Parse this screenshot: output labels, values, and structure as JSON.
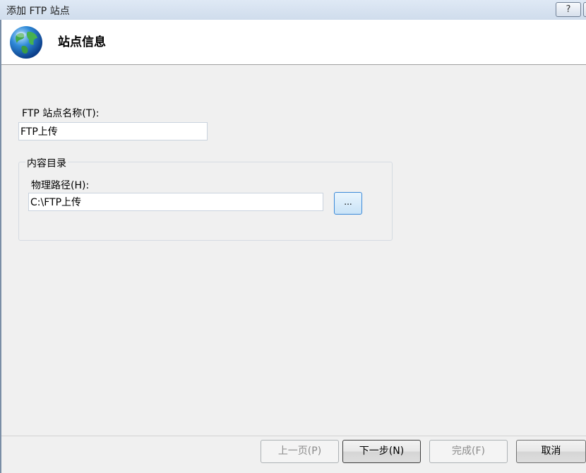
{
  "window": {
    "title": "添加 FTP 站点",
    "help_label": "?"
  },
  "header": {
    "title": "站点信息",
    "icon": "globe-icon"
  },
  "form": {
    "site_name_label": "FTP 站点名称(T):",
    "site_name_value": "FTP上传",
    "content_group_label": "内容目录",
    "physical_path_label": "物理路径(H):",
    "physical_path_value": "C:\\FTP上传",
    "browse_label": "..."
  },
  "footer": {
    "prev_label": "上一页(P)",
    "next_label": "下一步(N)",
    "finish_label": "完成(F)",
    "cancel_label": "取消"
  }
}
